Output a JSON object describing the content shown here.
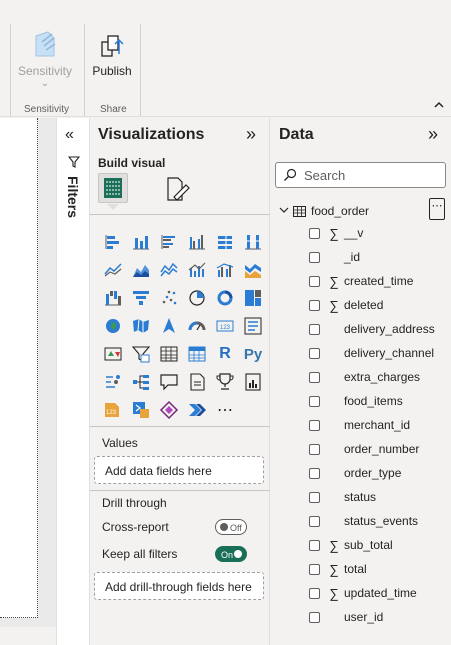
{
  "ribbon": {
    "sensitivity_label": "Sensitivity",
    "sensitivity_dropdown": "⌄",
    "publish_label": "Publish",
    "group_sensitivity": "Sensitivity",
    "group_share": "Share",
    "collapse_icon": "chevron-up-icon"
  },
  "filters": {
    "title": "Filters",
    "expand_glyph": "«"
  },
  "visualizations": {
    "title": "Visualizations",
    "collapse_glyph": "»",
    "build_visual_label": "Build visual",
    "more_visuals_glyph": "⋯",
    "values_label": "Values",
    "values_placeholder": "Add data fields here",
    "drill_through_label": "Drill through",
    "cross_report_label": "Cross-report",
    "cross_report_state": "Off",
    "keep_all_filters_label": "Keep all filters",
    "keep_all_filters_state": "On",
    "drill_placeholder": "Add drill-through fields here"
  },
  "data_pane": {
    "title": "Data",
    "collapse_glyph": "»",
    "search_placeholder": "Search",
    "table": {
      "name": "food_order",
      "more_glyph": "⋯",
      "fields": [
        {
          "name": "__v",
          "sigma": "∑"
        },
        {
          "name": "_id",
          "sigma": ""
        },
        {
          "name": "created_time",
          "sigma": "∑"
        },
        {
          "name": "deleted",
          "sigma": "∑"
        },
        {
          "name": "delivery_address",
          "sigma": ""
        },
        {
          "name": "delivery_channel",
          "sigma": ""
        },
        {
          "name": "extra_charges",
          "sigma": ""
        },
        {
          "name": "food_items",
          "sigma": ""
        },
        {
          "name": "merchant_id",
          "sigma": ""
        },
        {
          "name": "order_number",
          "sigma": ""
        },
        {
          "name": "order_type",
          "sigma": ""
        },
        {
          "name": "status",
          "sigma": ""
        },
        {
          "name": "status_events",
          "sigma": ""
        },
        {
          "name": "sub_total",
          "sigma": "∑"
        },
        {
          "name": "total",
          "sigma": "∑"
        },
        {
          "name": "updated_time",
          "sigma": "∑"
        },
        {
          "name": "user_id",
          "sigma": ""
        }
      ]
    }
  },
  "colors": {
    "accent_blue": "#2b7cd3",
    "toggle_on": "#1a6f59",
    "python_blue": "#3776ab",
    "r_blue": "#276dc3"
  }
}
